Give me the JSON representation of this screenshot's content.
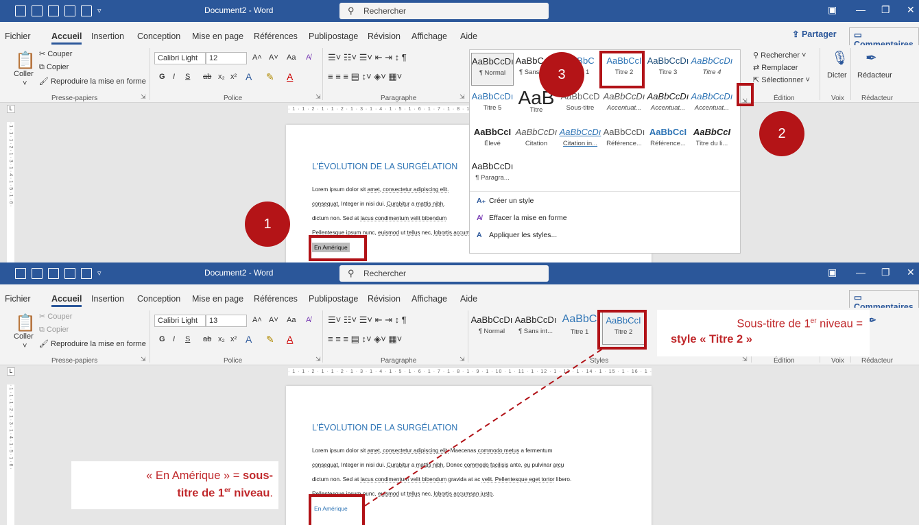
{
  "title": "Document2 - Word",
  "search_label": "Rechercher",
  "tabs": [
    "Fichier",
    "Accueil",
    "Insertion",
    "Conception",
    "Mise en page",
    "Références",
    "Publipostage",
    "Révision",
    "Affichage",
    "Aide"
  ],
  "share_label": "Partager",
  "comments_label": "Commentaires",
  "clipboard": {
    "paste": "Coller",
    "cut": "Couper",
    "copy": "Copier",
    "format_painter": "Reproduire la mise en forme",
    "group": "Presse-papiers"
  },
  "font": {
    "name": "Calibri Light",
    "size_top": "12",
    "size_bottom": "13",
    "group": "Police",
    "bold": "G",
    "italic": "I",
    "underline": "S",
    "strike": "ab",
    "sub": "x₂",
    "sup": "x²",
    "grow": "A˄",
    "shrink": "A˅",
    "case": "Aa"
  },
  "paragraph": {
    "group": "Paragraphe"
  },
  "styles_group": "Styles",
  "editing": {
    "find": "Rechercher",
    "replace": "Remplacer",
    "select": "Sélectionner",
    "group": "Édition"
  },
  "voice": {
    "dictate": "Dicter",
    "group": "Voix"
  },
  "editor": {
    "label": "Rédacteur",
    "group": "Rédacteur"
  },
  "ruler_text": "· 1 · 1 · 2 · 1 · 1 · 2 · 1 · 3 · 1 · 4 · 1 · 5 · 1 · 6 · 1 · 7 · 1 · 8 · 1 · 9 · 1 · 10 · 1 · 11 · 1 · 12 · 1 · 13 · 1 · 14 · 1 · 15 · 1 · 16 · 1 · 17 · 1 · 18 · 1 · 19 ·",
  "vruler_text": "· 1 · 1 · 1 · 2 · 1 · 3 · 1 · 4 · 1 · 5 · 1 · 6 ·",
  "doc": {
    "heading": "L’ÉVOLUTION DE LA SURGÉLATION",
    "line1_a": "Lorem ipsum dolor sit ",
    "line1_b": "amet, consectetur adipiscing elit.",
    "line1_c": " Maecenas ",
    "line1_d": "commodo metus",
    "line1_e": " a fermentum",
    "line2_a": "consequat.",
    "line2_b": " Integer in nisi dui. ",
    "line2_c": "Curabitur",
    "line2_d": " a ",
    "line2_e": "mattis nibh.",
    "line2_f": " Donec ",
    "line2_g": "commodo facilisis",
    "line2_h": " ante, ",
    "line2_i": "eu",
    "line2_j": " pulvinar ",
    "line2_k": "arcu",
    "line3_a": "dictum non. Sed at ",
    "line3_b": "lacus condimentum velit bibendum",
    "line3_c": " gravida at ac ",
    "line3_d": "velit. Pellentesque eget tortor",
    "line3_e": " libero.",
    "line4_a": "Pellentesque",
    "line4_b": " ipsum nunc, ",
    "line4_c": "euismod",
    "line4_d": " ut ",
    "line4_e": "tellus",
    "line4_f": " nec, ",
    "line4_g": "lobortis accumsan justo.",
    "subtitle": "En Amérique"
  },
  "gallery_top": [
    {
      "preview": "AaBbCcDı",
      "name": "¶ Normal"
    },
    {
      "preview": "AaBbCcDı",
      "name": "¶ Sans int..."
    },
    {
      "preview": "AaBbC",
      "name": "Titre 1"
    },
    {
      "preview": "AaBbCcI",
      "name": "Titre 2"
    },
    {
      "preview": "AaBbCcDı",
      "name": "Titre 3"
    },
    {
      "preview": "AaBbCcDı",
      "name": "Titre 4"
    }
  ],
  "gallery_row2": [
    {
      "preview": "AaBbCcDı",
      "name": "Titre 5"
    },
    {
      "preview": "AaB",
      "name": "Titre"
    },
    {
      "preview": "AaBbCcD",
      "name": "Sous-titre"
    },
    {
      "preview": "AaBbCcDı",
      "name": "Accentuat..."
    },
    {
      "preview": "AaBbCcDı",
      "name": "Accentuat..."
    },
    {
      "preview": "AaBbCcDı",
      "name": "Accentuat..."
    }
  ],
  "gallery_row3": [
    {
      "preview": "AaBbCcI",
      "name": "Élevé"
    },
    {
      "preview": "AaBbCcDı",
      "name": "Citation"
    },
    {
      "preview": "AaBbCcDı",
      "name": "Citation in..."
    },
    {
      "preview": "AaBbCcDı",
      "name": "Référence..."
    },
    {
      "preview": "AaBbCcI",
      "name": "Référence..."
    },
    {
      "preview": "AaBbCcI",
      "name": "Titre du li..."
    }
  ],
  "gallery_row4": [
    {
      "preview": "AaBbCcDı",
      "name": "¶ Paragra..."
    }
  ],
  "style_menu": [
    "Créer un style",
    "Effacer la mise en forme",
    "Appliquer les styles..."
  ],
  "badges": [
    "1",
    "2",
    "3"
  ],
  "callout_right": {
    "l1a": "Sous-titre de 1",
    "sup": "er",
    "l1b": " niveau =",
    "l2": "style « Titre 2 »"
  },
  "callout_left": {
    "l1a": "« En Amérique » = ",
    "l1b": "sous-",
    "l2a": "titre de 1",
    "sup": "er",
    "l2b": " niveau",
    "l2c": "."
  },
  "colors": {
    "word_blue": "#2b579a",
    "annotation_red": "#b11217",
    "heading_blue": "#2e74b5"
  }
}
